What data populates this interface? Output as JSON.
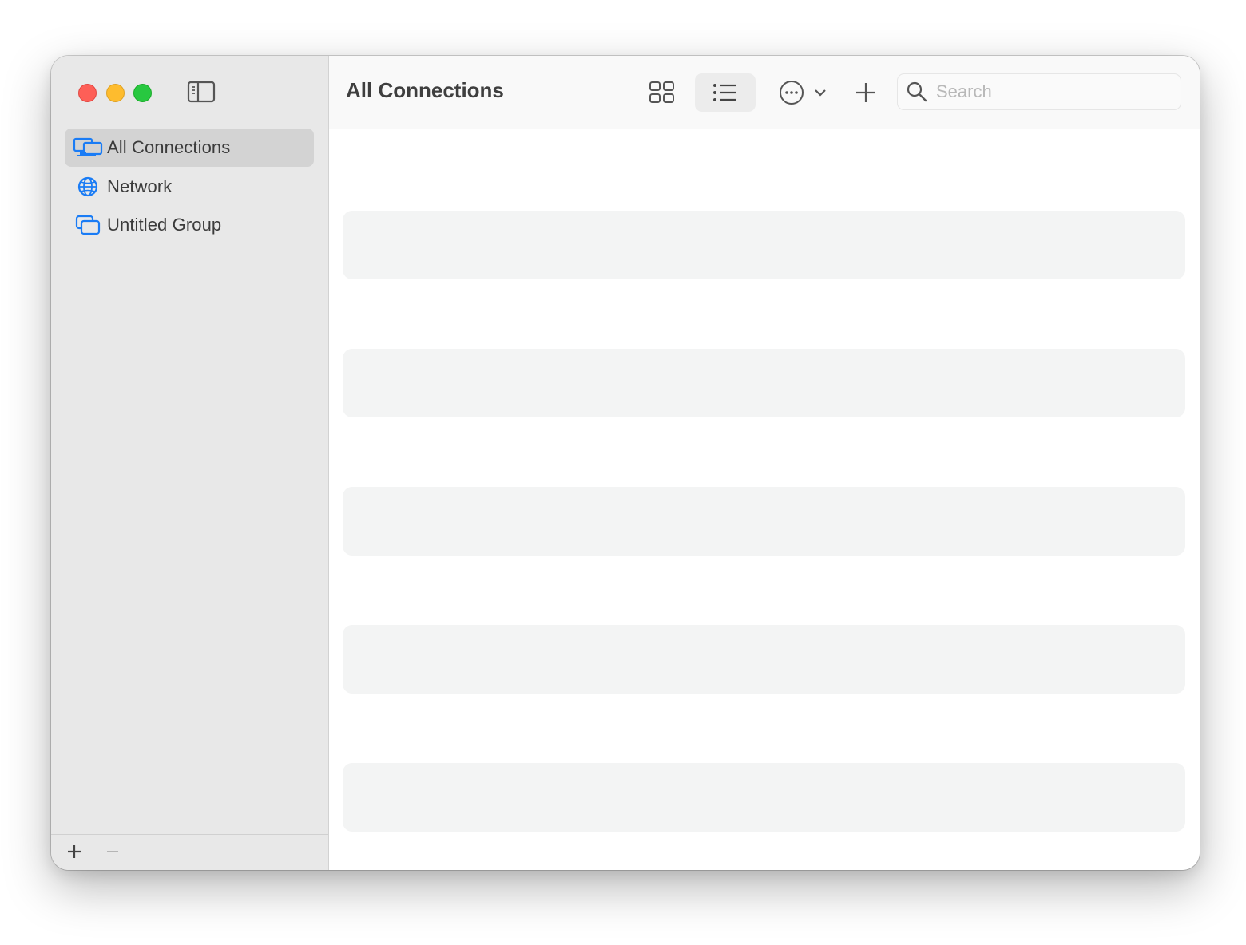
{
  "window": {
    "controls": [
      "close",
      "minimize",
      "zoom"
    ]
  },
  "sidebar": {
    "toggle_icon": "sidebar-toggle-icon",
    "items": [
      {
        "label": "All Connections",
        "icon": "displays-icon",
        "selected": true
      },
      {
        "label": "Network",
        "icon": "globe-icon",
        "selected": false
      },
      {
        "label": "Untitled Group",
        "icon": "group-windows-icon",
        "selected": false
      }
    ],
    "footer": {
      "add_label": "+",
      "remove_label": "−"
    }
  },
  "toolbar": {
    "title": "All Connections",
    "view_grid_icon": "grid-view-icon",
    "view_list_icon": "list-view-icon",
    "active_view": "list",
    "more_icon": "ellipsis-circle-icon",
    "add_icon": "plus-icon",
    "search": {
      "placeholder": "Search",
      "value": ""
    }
  },
  "content": {
    "rows": [
      {},
      {},
      {},
      {},
      {}
    ]
  },
  "colors": {
    "accent": "#1a7cf5",
    "sidebar_bg": "#e8e8e8",
    "selected_bg": "#d3d3d3",
    "row_placeholder": "#f3f4f4",
    "close": "#fe5f57",
    "minimize": "#febc2e",
    "zoom": "#28c840"
  }
}
